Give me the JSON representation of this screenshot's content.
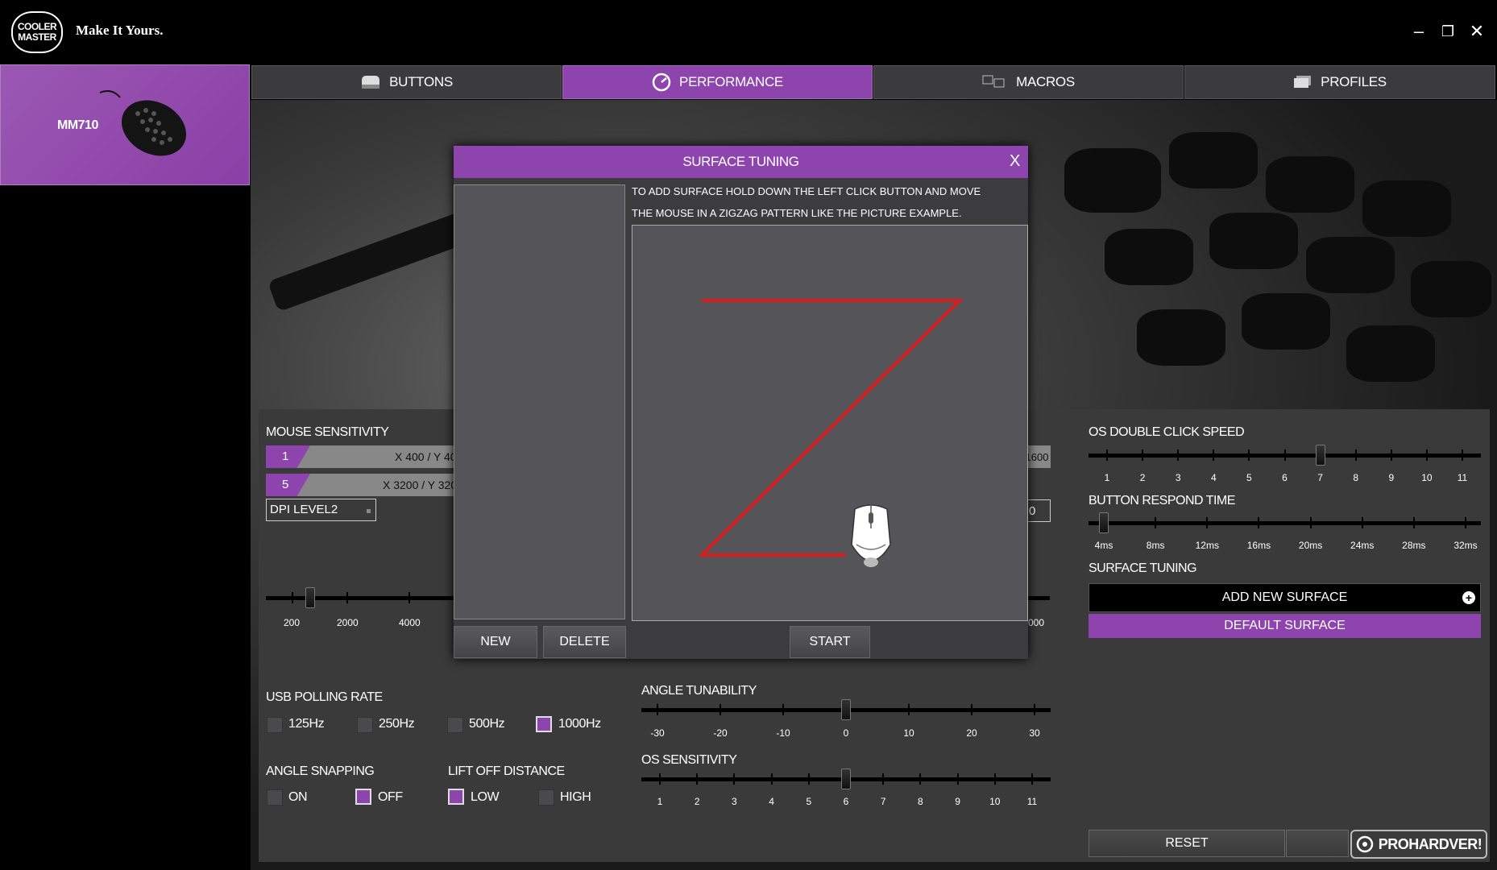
{
  "app": {
    "brand_line1": "COOLER",
    "brand_line2": "MASTER",
    "tagline": "Make It Yours."
  },
  "window_controls": {
    "minimize": "–",
    "restore": "❐",
    "close": "✕"
  },
  "device": {
    "name": "MM710"
  },
  "tabs": [
    {
      "label": "BUTTONS",
      "icon": "mouse-icon",
      "active": false
    },
    {
      "label": "PERFORMANCE",
      "icon": "gauge-icon",
      "active": true
    },
    {
      "label": "MACROS",
      "icon": "macro-icon",
      "active": false
    },
    {
      "label": "PROFILES",
      "icon": "profiles-icon",
      "active": false
    }
  ],
  "mouse_sensitivity": {
    "title": "MOUSE SENSITIVITY",
    "levels": [
      {
        "num": "1",
        "value": "X 400 / Y 400"
      },
      {
        "num": "5",
        "value": "X 3200 / Y 3200"
      }
    ],
    "right_value_1": "1600",
    "right_value_2": "0",
    "dpi_select": "DPI LEVEL2",
    "slider_labels": [
      "200",
      "2000",
      "4000"
    ],
    "slider_right_label": "000"
  },
  "usb_polling": {
    "title": "USB POLLING RATE",
    "options": [
      {
        "label": "125Hz",
        "checked": false
      },
      {
        "label": "250Hz",
        "checked": false
      },
      {
        "label": "500Hz",
        "checked": false
      },
      {
        "label": "1000Hz",
        "checked": true
      }
    ]
  },
  "angle_snapping": {
    "title": "ANGLE SNAPPING",
    "options": [
      {
        "label": "ON",
        "checked": false
      },
      {
        "label": "OFF",
        "checked": true
      }
    ]
  },
  "lift_off": {
    "title": "LIFT OFF DISTANCE",
    "options": [
      {
        "label": "LOW",
        "checked": true
      },
      {
        "label": "HIGH",
        "checked": false
      }
    ]
  },
  "angle_tunability": {
    "title": "ANGLE TUNABILITY",
    "labels": [
      "-30",
      "-20",
      "-10",
      "0",
      "10",
      "20",
      "30"
    ],
    "value": 0
  },
  "os_sensitivity": {
    "title": "OS SENSITIVITY",
    "labels": [
      "1",
      "2",
      "3",
      "4",
      "5",
      "6",
      "7",
      "8",
      "9",
      "10",
      "11"
    ],
    "value": 6
  },
  "os_double_click": {
    "title": "OS DOUBLE CLICK SPEED",
    "labels": [
      "1",
      "2",
      "3",
      "4",
      "5",
      "6",
      "7",
      "8",
      "9",
      "10",
      "11"
    ],
    "value": 7
  },
  "button_respond": {
    "title": "BUTTON RESPOND TIME",
    "labels": [
      "4ms",
      "8ms",
      "12ms",
      "16ms",
      "20ms",
      "24ms",
      "28ms",
      "32ms"
    ],
    "value": "4ms"
  },
  "surface_tuning": {
    "title": "SURFACE TUNING",
    "add_label": "ADD NEW SURFACE",
    "add_icon": "plus-circle-icon",
    "default_label": "DEFAULT SURFACE"
  },
  "reset_label": "RESET",
  "dialog": {
    "title": "SURFACE TUNING",
    "close": "X",
    "instruction_line1": "TO ADD SURFACE HOLD DOWN THE LEFT CLICK BUTTON AND MOVE",
    "instruction_line2": "THE MOUSE IN A ZIGZAG PATTERN LIKE THE PICTURE EXAMPLE.",
    "new_label": "NEW",
    "delete_label": "DELETE",
    "start_label": "START",
    "zigzag_color": "#d81e1e"
  },
  "watermark": "PROHARDVER!",
  "colors": {
    "accent": "#8e44ad",
    "panel": "#3a3a3a"
  }
}
